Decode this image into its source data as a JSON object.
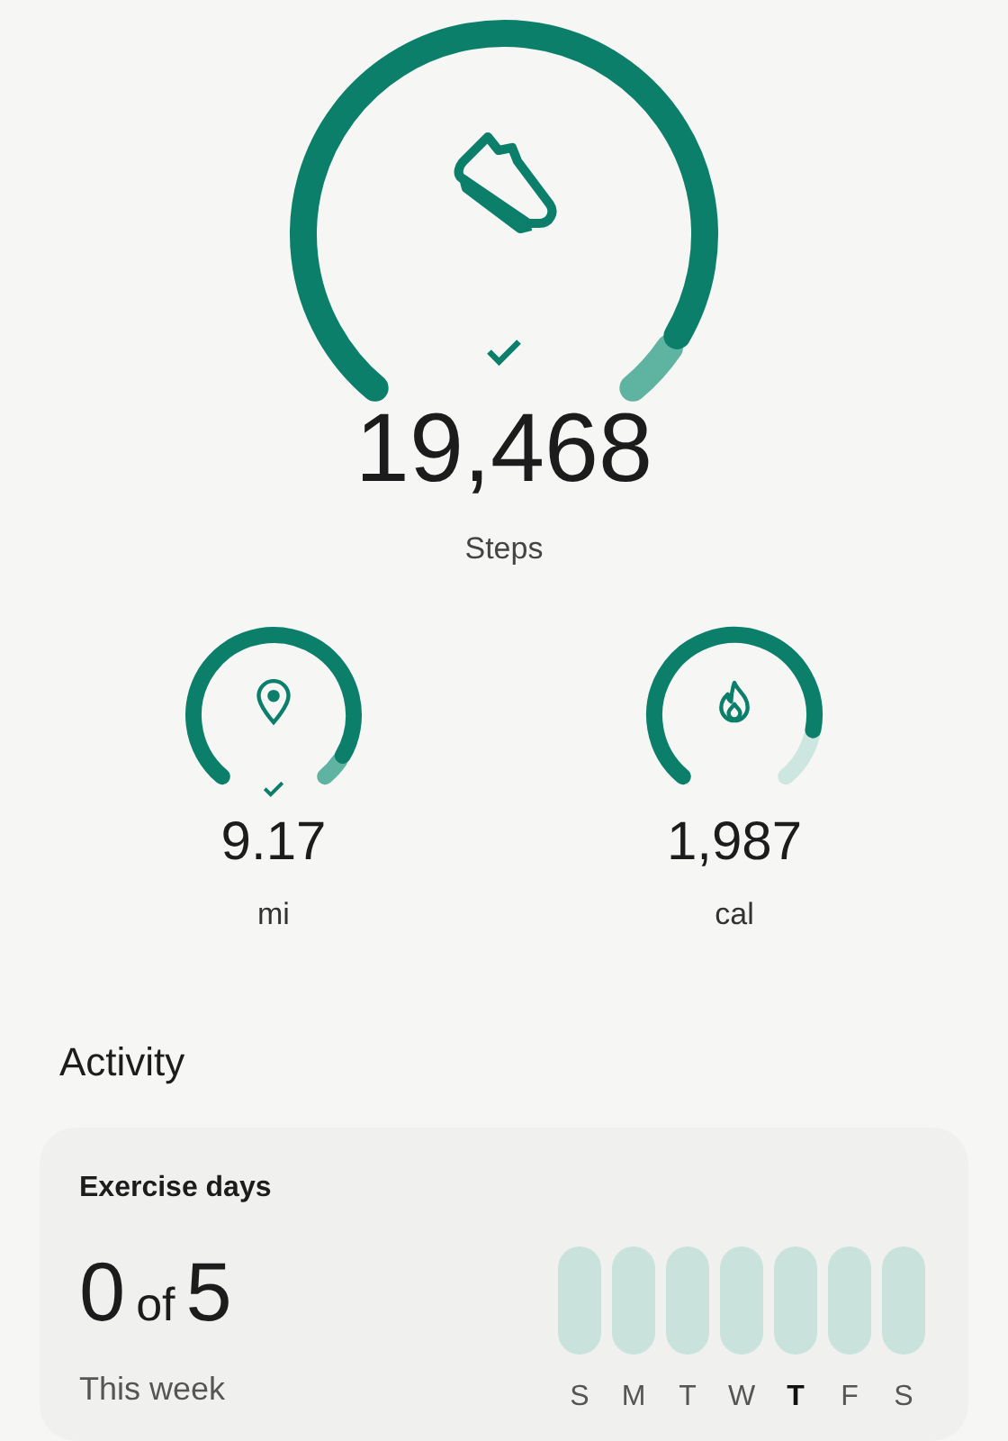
{
  "steps": {
    "value": "19,468",
    "label": "Steps",
    "goal_met": true
  },
  "metrics": [
    {
      "kind": "distance",
      "value": "9.17",
      "unit": "mi",
      "goal_met": true
    },
    {
      "kind": "calories",
      "value": "1,987",
      "unit": "cal",
      "goal_met": false
    }
  ],
  "section_title": "Activity",
  "exercise_card": {
    "title": "Exercise days",
    "count": "0",
    "of": "of",
    "goal": "5",
    "period": "This week",
    "days": [
      {
        "label": "S",
        "selected": false
      },
      {
        "label": "M",
        "selected": false
      },
      {
        "label": "T",
        "selected": false
      },
      {
        "label": "W",
        "selected": false
      },
      {
        "label": "T",
        "selected": true
      },
      {
        "label": "F",
        "selected": false
      },
      {
        "label": "S",
        "selected": false
      }
    ]
  }
}
